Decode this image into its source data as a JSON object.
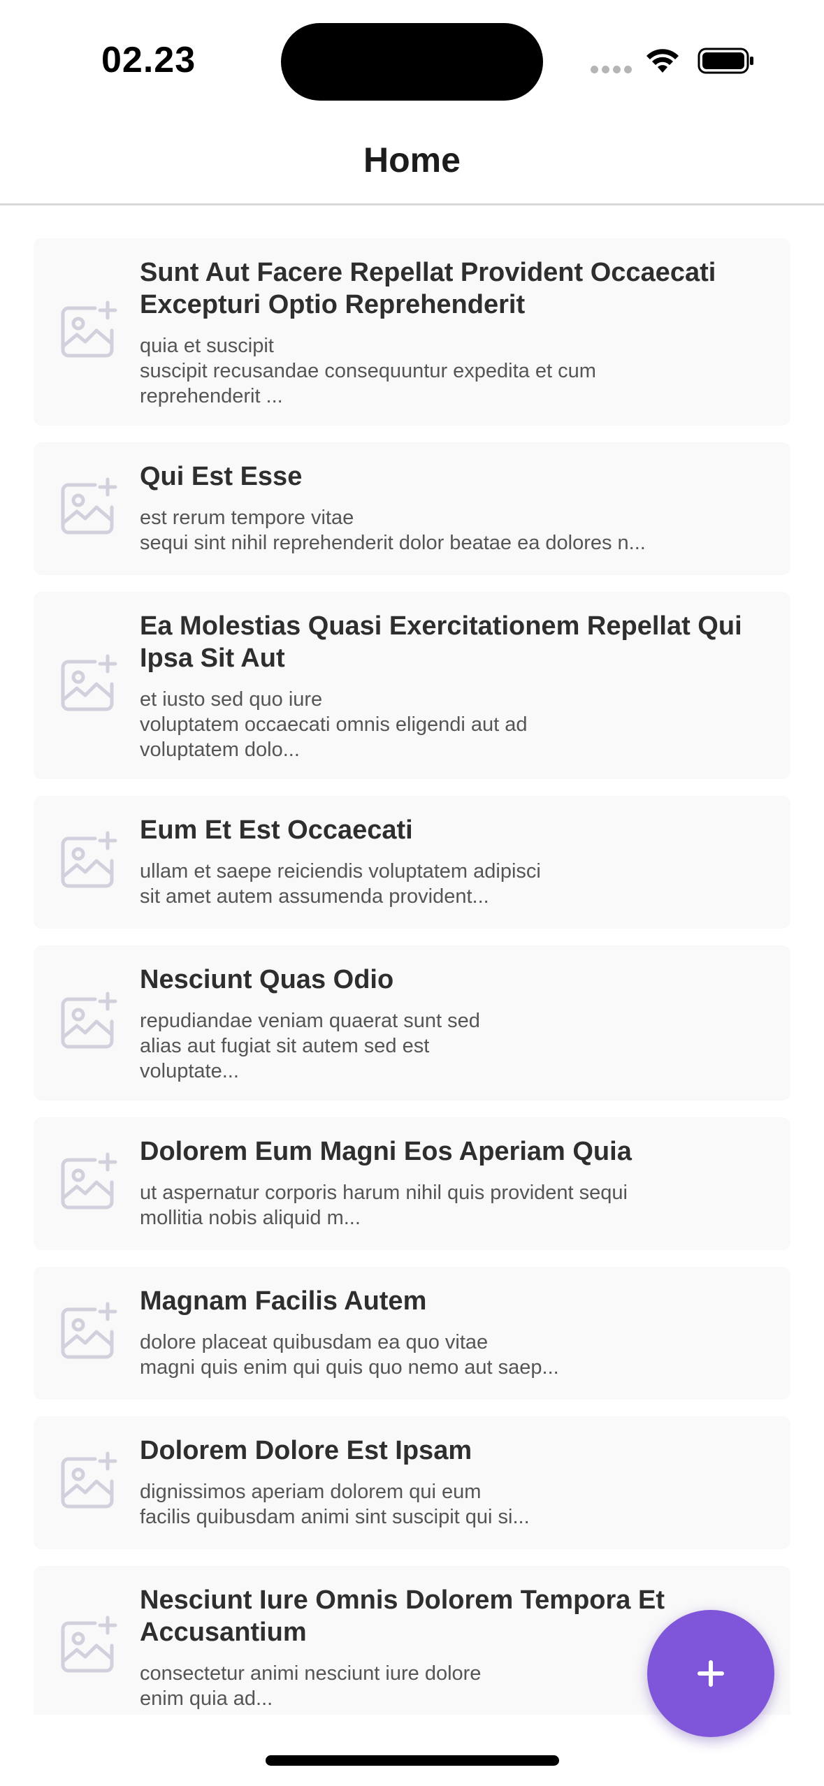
{
  "status_bar": {
    "time": "02.23"
  },
  "header": {
    "title": "Home"
  },
  "posts": [
    {
      "title": "Sunt Aut Facere Repellat Provident Occaecati Excepturi Optio Reprehenderit",
      "body": "quia et suscipit\nsuscipit recusandae consequuntur expedita et cum\nreprehenderit ..."
    },
    {
      "title": "Qui Est Esse",
      "body": "est rerum tempore vitae\nsequi sint nihil reprehenderit dolor beatae ea dolores n..."
    },
    {
      "title": "Ea Molestias Quasi Exercitationem Repellat Qui Ipsa Sit Aut",
      "body": "et iusto sed quo iure\nvoluptatem occaecati omnis eligendi aut ad\nvoluptatem dolo..."
    },
    {
      "title": "Eum Et Est Occaecati",
      "body": "ullam et saepe reiciendis voluptatem adipisci\nsit amet autem assumenda provident..."
    },
    {
      "title": "Nesciunt Quas Odio",
      "body": "repudiandae veniam quaerat sunt sed\nalias aut fugiat sit autem sed est\nvoluptate..."
    },
    {
      "title": "Dolorem Eum Magni Eos Aperiam Quia",
      "body": "ut aspernatur corporis harum nihil quis provident sequi\nmollitia nobis aliquid m..."
    },
    {
      "title": "Magnam Facilis Autem",
      "body": "dolore placeat quibusdam ea quo vitae\nmagni quis enim qui quis quo nemo aut saep..."
    },
    {
      "title": "Dolorem Dolore Est Ipsam",
      "body": "dignissimos aperiam dolorem qui eum\nfacilis quibusdam animi sint suscipit qui si..."
    },
    {
      "title": "Nesciunt Iure Omnis Dolorem Tempora Et Accusantium",
      "body": "consectetur animi nesciunt iure dolore\nenim quia ad..."
    }
  ],
  "fab": {
    "icon": "plus-icon",
    "color": "#7f56d9"
  },
  "colors": {
    "card_background": "#f9f9f9",
    "placeholder_icon": "#d2d0dc",
    "accent": "#7f56d9"
  }
}
